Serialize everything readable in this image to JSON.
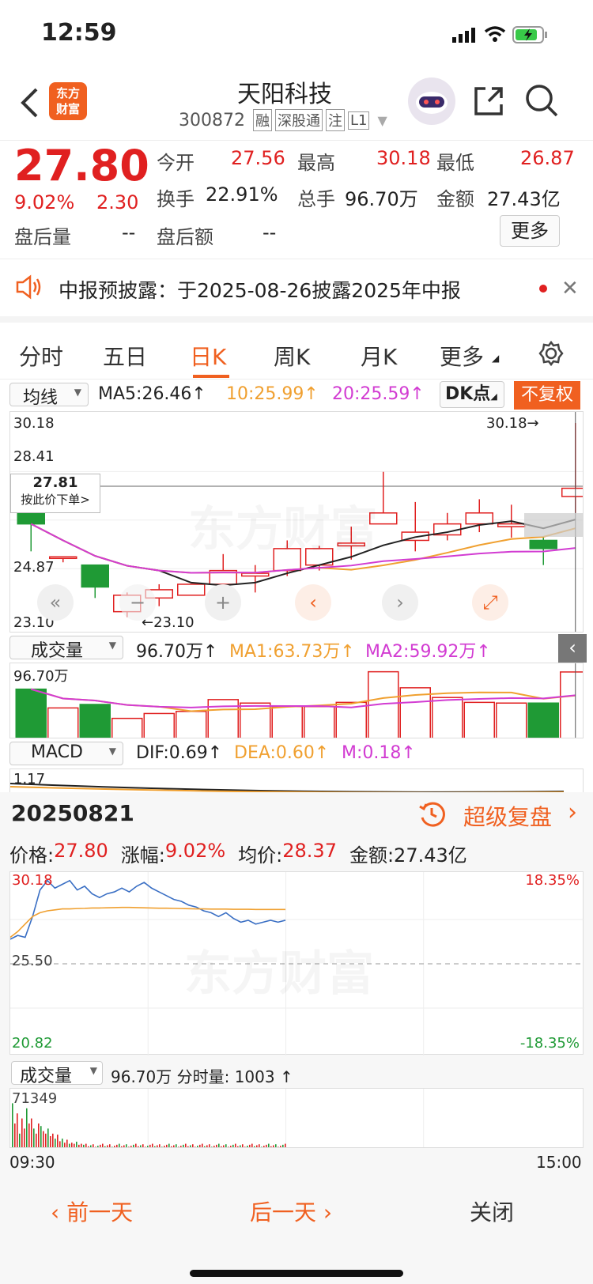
{
  "status": {
    "time": "12:59"
  },
  "header": {
    "logo_line1": "东方",
    "logo_line2": "财富",
    "name": "天阳科技",
    "code": "300872",
    "tags": [
      "融",
      "深股通",
      "注",
      "L1"
    ]
  },
  "quote": {
    "price": "27.80",
    "pct": "9.02%",
    "chg": "2.30",
    "labels": {
      "open": "今开",
      "high": "最高",
      "low": "最低",
      "turnover": "换手",
      "vol": "总手",
      "amount": "金额",
      "after_vol": "盘后量",
      "after_amt": "盘后额",
      "more": "更多"
    },
    "open": "27.56",
    "high": "30.18",
    "low": "26.87",
    "turnover": "22.91%",
    "vol": "96.70万",
    "amount": "27.43亿",
    "after_vol": "--",
    "after_amt": "--"
  },
  "notice": {
    "text": "中报预披露：于2025-08-26披露2025年中报"
  },
  "tabs": [
    "分时",
    "五日",
    "日K",
    "周K",
    "月K",
    "更多"
  ],
  "active_tab": "日K",
  "kline": {
    "ma_select": "均线",
    "ma5": "MA5:26.46↑",
    "ma10": "10:25.99↑",
    "ma20": "20:25.59↑",
    "dk": "DK点",
    "fq": "不复权",
    "y_labels": [
      "30.18",
      "28.41",
      "24.87",
      "23.10"
    ],
    "high_tag": "30.18→",
    "low_tag": "←23.10",
    "cursor_price": "27.81",
    "cursor_order": "按此价下单>",
    "vol_select": "成交量",
    "vol": "96.70万↑",
    "vol_ma1": "MA1:63.73万↑",
    "vol_ma2": "MA2:59.92万↑",
    "vol_max": "96.70万",
    "macd_select": "MACD",
    "dif": "DIF:0.69↑",
    "dea": "DEA:0.60↑",
    "m": "M:0.18↑",
    "macd_top": "1.17",
    "candles": [
      [
        26.9,
        26.5,
        25.5,
        27.2
      ],
      [
        25.3,
        25.3,
        25.1,
        25.3
      ],
      [
        25.0,
        24.2,
        23.8,
        25.0
      ],
      [
        23.3,
        23.9,
        23.1,
        24.0
      ],
      [
        23.8,
        24.1,
        23.5,
        24.3
      ],
      [
        23.9,
        24.3,
        23.9,
        24.3
      ],
      [
        24.3,
        24.8,
        24.1,
        25.4
      ],
      [
        24.6,
        24.7,
        24.0,
        25.0
      ],
      [
        24.8,
        25.6,
        24.6,
        25.9
      ],
      [
        25.0,
        25.6,
        24.8,
        25.7
      ],
      [
        25.7,
        25.8,
        25.2,
        26.4
      ],
      [
        26.5,
        26.9,
        26.5,
        28.4
      ],
      [
        25.9,
        26.2,
        25.5,
        27.3
      ],
      [
        26.1,
        26.5,
        25.9,
        26.9
      ],
      [
        26.5,
        26.9,
        26.2,
        27.4
      ],
      [
        26.4,
        26.5,
        26.0,
        27.2
      ],
      [
        25.9,
        25.6,
        25.0,
        26.0
      ],
      [
        27.5,
        27.8,
        26.9,
        30.18
      ]
    ],
    "vol_values": [
      0.72,
      0.45,
      0.5,
      0.3,
      0.37,
      0.4,
      0.57,
      0.52,
      0.47,
      0.47,
      0.53,
      0.97,
      0.74,
      0.6,
      0.53,
      0.52,
      0.52,
      0.967
    ]
  },
  "detail": {
    "date": "20250821",
    "replay": "超级复盘",
    "price_l": "价格:",
    "price": "27.80",
    "pct_l": "涨幅:",
    "pct": "9.02%",
    "avg_l": "均价:",
    "avg": "28.37",
    "amount": "金额:27.43亿",
    "ymax": "30.18",
    "ymid": "25.50",
    "ymin": "20.82",
    "pmax": "18.35%",
    "pmin": "-18.35%",
    "vol_select": "成交量",
    "vol": "96.70万 分时量: 1003 ↑",
    "vol_max": "71349",
    "t_start": "09:30",
    "t_end": "15:00"
  },
  "footer": {
    "prev": "前一天",
    "next": "后一天",
    "close": "关闭"
  }
}
